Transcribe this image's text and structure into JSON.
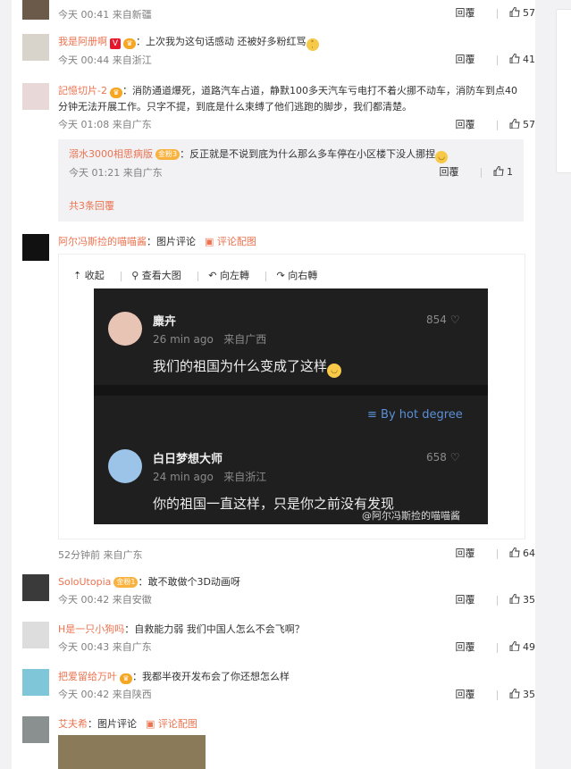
{
  "comments": [
    {
      "meta": "今天 00:41 来自新疆",
      "reply": "回覆",
      "likes": "57"
    },
    {
      "user": "我是阿册啊",
      "text": "：上次我为这句话感动 还被好多粉红骂",
      "meta": "今天 00:44 来自浙江",
      "reply": "回覆",
      "likes": "41"
    },
    {
      "user": "記憶切片-2",
      "text": "：消防通道爆死，道路汽车占道，静默100多天汽车亏电打不着火挪不动车，消防车到点40分钟无法开展工作。只字不提，到底是什么束缚了他们逃跑的脚步，我们都清楚。",
      "meta": "今天 01:08 来自广东",
      "reply": "回覆",
      "likes": "57"
    }
  ],
  "subreply": {
    "user": "溺水3000相思病版",
    "badge": "金粉3",
    "text": "：反正就是不说到底为什么那么多车停在小区楼下没人挪捏",
    "meta": "今天 01:21 来自广东",
    "reply": "回覆",
    "likes": "1"
  },
  "more_replies": "共3条回覆",
  "image_post": {
    "user": "阿尔冯斯捡的喵喵酱",
    "type": "：图片评论",
    "pic_link": "评论配图",
    "toolbar": [
      "收起",
      "查看大图",
      "向左轉",
      "向右轉"
    ],
    "meta": "52分钟前 来自广东",
    "reply": "回覆",
    "likes": "64"
  },
  "screenshot": {
    "c1_name": "麋卉",
    "c1_time": "26 min ago",
    "c1_loc": "来自广西",
    "c1_likes": "854",
    "c1_text": "我们的祖国为什么变成了这样",
    "sort": "By hot degree",
    "c2_name": "白日梦想大师",
    "c2_time": "24 min ago",
    "c2_loc": "来自浙江",
    "c2_likes": "658",
    "c2_text": "你的祖国一直这样，只是你之前没有发现",
    "watermark": "@阿尔冯斯捡的喵喵酱"
  },
  "comments2": [
    {
      "user": "SoloUtopia",
      "badge": "金粉1",
      "text": "：敢不敢做个3D动画呀",
      "meta": "今天 00:42 来自安徽",
      "reply": "回覆",
      "likes": "35"
    },
    {
      "user": "H是一只小狗吗",
      "text": "：自救能力弱 我们中国人怎么不会飞啊？",
      "meta": "今天 00:43 来自广东",
      "reply": "回覆",
      "likes": "49"
    },
    {
      "user": "把爱留给万叶",
      "text": "：我都半夜开发布会了你还想怎么样",
      "meta": "今天 00:42 来自陕西",
      "reply": "回覆",
      "likes": "35"
    }
  ],
  "last_post": {
    "user": "艾夫希",
    "type": "：图片评论",
    "pic_link": "评论配图"
  }
}
